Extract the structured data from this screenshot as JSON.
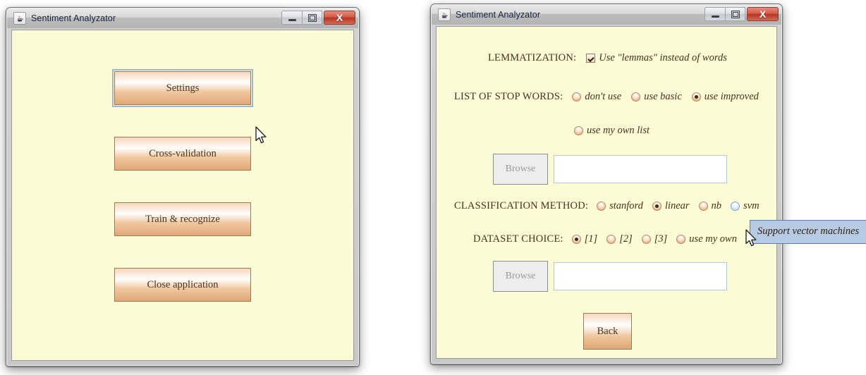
{
  "left_window": {
    "title": "Sentiment Analyzator",
    "icon": "java-coffee-cup-icon",
    "caption": {
      "minimize": "minimize-icon",
      "maximize": "maximize-icon",
      "close": "X"
    },
    "buttons": [
      {
        "label": "Settings",
        "focused": true
      },
      {
        "label": "Cross-validation",
        "focused": false
      },
      {
        "label": "Train & recognize",
        "focused": false
      },
      {
        "label": "Close application",
        "focused": false
      }
    ]
  },
  "right_window": {
    "title": "Sentiment Analyzator",
    "icon": "java-coffee-cup-icon",
    "caption": {
      "minimize": "minimize-icon",
      "maximize": "maximize-icon",
      "close": "X"
    },
    "lemmatization": {
      "label": "LEMMATIZATION:",
      "checkbox_label": "Use \"lemmas\" instead of words",
      "checked": true
    },
    "stop_words": {
      "label": "LIST OF STOP WORDS:",
      "options": [
        {
          "label": "don't use",
          "selected": false
        },
        {
          "label": "use basic",
          "selected": false
        },
        {
          "label": "use improved",
          "selected": true
        }
      ],
      "own_option": {
        "label": "use my own list",
        "selected": false
      },
      "browse_label": "Browse",
      "browse_enabled": false,
      "path_value": "",
      "path_placeholder": ""
    },
    "classification": {
      "label": "CLASSIFICATION METHOD:",
      "options": [
        {
          "label": "stanford",
          "selected": false,
          "hover": false
        },
        {
          "label": "linear",
          "selected": true,
          "hover": false
        },
        {
          "label": "nb",
          "selected": false,
          "hover": false
        },
        {
          "label": "svm",
          "selected": false,
          "hover": true
        }
      ]
    },
    "dataset": {
      "label": "DATASET CHOICE:",
      "options": [
        {
          "label": "[1]",
          "selected": true
        },
        {
          "label": "[2]",
          "selected": false
        },
        {
          "label": "[3]",
          "selected": false
        },
        {
          "label": "use my own",
          "selected": false
        }
      ],
      "browse_label": "Browse",
      "browse_enabled": false,
      "path_value": "",
      "path_placeholder": ""
    },
    "back_button": {
      "label": "Back"
    },
    "tooltip": {
      "text": "Support vector machines",
      "target": "svm"
    }
  },
  "colors": {
    "client_bg": "#fbfbd6",
    "button_accent": "#e0a878",
    "tooltip_bg": "#b7cce4",
    "tooltip_border": "#5a7fae",
    "title_text": "#15233f",
    "label_text": "#4a2f1d"
  }
}
